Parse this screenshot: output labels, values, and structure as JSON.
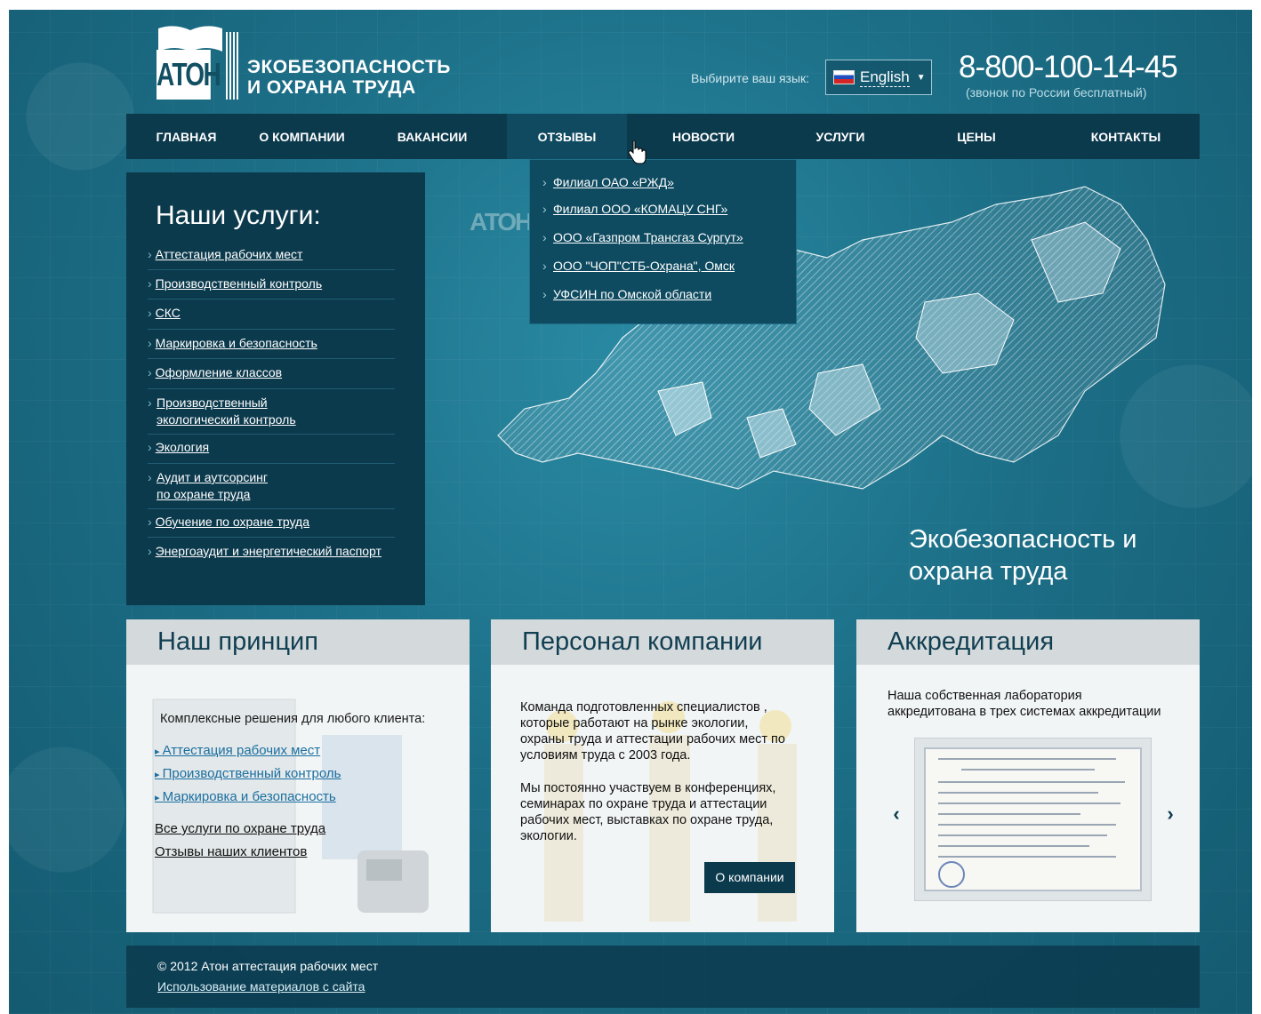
{
  "header": {
    "brand_line1": "ЭКОБЕЗОПАСНОСТЬ",
    "brand_line2": "И ОХРАНА ТРУДА",
    "logo_text": "АТОН",
    "lang_label": "Выбирите ваш язык:",
    "lang_value": "English",
    "phone": "8-800-100-14-45",
    "phone_note": "(звонок по России бесплатный)"
  },
  "nav": {
    "items": [
      {
        "label": "ГЛАВНАЯ"
      },
      {
        "label": "О КОМПАНИИ"
      },
      {
        "label": "ВАКАНСИИ"
      },
      {
        "label": "ОТЗЫВЫ"
      },
      {
        "label": "НОВОСТИ"
      },
      {
        "label": "УСЛУГИ"
      },
      {
        "label": "ЦЕНЫ"
      },
      {
        "label": "КОНТАКТЫ"
      }
    ],
    "active": "ОТЗЫВЫ",
    "dropdown": [
      "Филиал ОАО «РЖД»",
      "Филиал ООО «КОМАЦУ СНГ»",
      "ООО «Газпром Трансгаз Сургут»",
      "ООО \"ЧОП\"СТБ-Охрана\", Омск",
      "УФСИН по Омской области"
    ]
  },
  "services": {
    "title": "Наши услуги:",
    "items": [
      "Аттестация рабочих мест",
      "Производственный контроль",
      "СКС",
      "Маркировка и безопасность",
      "Оформление классов",
      [
        "Производственный",
        "экологический контроль"
      ],
      "Экология",
      [
        "Аудит и аутсорсинг",
        "по охране труда"
      ],
      "Обучение по охране труда",
      "Энергоаудит и энергетический паспорт"
    ]
  },
  "hero": {
    "watermark": "АТОН",
    "line1": "Экобезопасность и",
    "line2": "охрана труда"
  },
  "cards": {
    "principle": {
      "title": "Наш принцип",
      "intro": "Комплексные решения для любого клиента:",
      "links": [
        "Аттестация рабочих мест",
        "Производственный контроль",
        "Маркировка и безопасность"
      ],
      "all_services": "Все услуги по охране труда",
      "reviews": "Отзывы наших клиентов"
    },
    "staff": {
      "title": "Персонал компании",
      "p1": [
        "Команда подготовленных специалистов ,",
        "которые работают на рынке экологии,",
        "охраны труда и аттестации рабочих мест по",
        "условиям труда с 2003 года."
      ],
      "p2": [
        "Мы постоянно участвуем в конференциях,",
        "семинарах по охране труда и аттестации",
        "рабочих мест, выставках по охране труда,",
        "экологии."
      ],
      "button": "О компании"
    },
    "accreditation": {
      "title": "Аккредитация",
      "text1": "Наша собственная лаборатория",
      "text2": "аккредитована в трех системах аккредитации",
      "prev": "‹",
      "next": "›"
    }
  },
  "footer": {
    "copyright": "© 2012 Атон аттестация рабочих мест",
    "usage": "Использование материалов с сайта"
  }
}
